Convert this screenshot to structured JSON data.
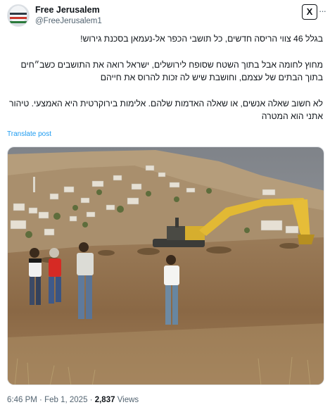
{
  "post": {
    "author_name": "Free Jerusalem",
    "author_handle": "@FreeJerusalem1",
    "logo_label": "X",
    "menu_label": "···",
    "paragraphs": [
      "בגלל 46 צווי הריסה חדשים, כל תושבי הכפר אל-נעמאן בסכנת גירוש!",
      "מחוץ לחומה אבל בתוך השטח שסופח לירושלים, ישראל רואה את התושבים כשב״חים בתוך הבתים של עצמם, וחושבת שיש לה זכות להרוס את חייהם",
      "לא חשוב שאלה אנשים, או שאלה האדמות שלהם. אלימות בירוקרטית היא האמצעי. טיהור אתני הוא המטרה"
    ],
    "translate_label": "Translate post",
    "time": "6:46 PM",
    "separator": "·",
    "date": "Feb 1, 2025",
    "views_count": "2,837",
    "views_label": "Views"
  },
  "colors": {
    "link": "#1d9bf0",
    "sky": "#8c9096",
    "hill": "#b8a180",
    "ground": "#8b6a47",
    "excavator": "#e2b934"
  },
  "icons": {
    "x_logo": "x-logo-icon",
    "menu": "more-icon"
  }
}
